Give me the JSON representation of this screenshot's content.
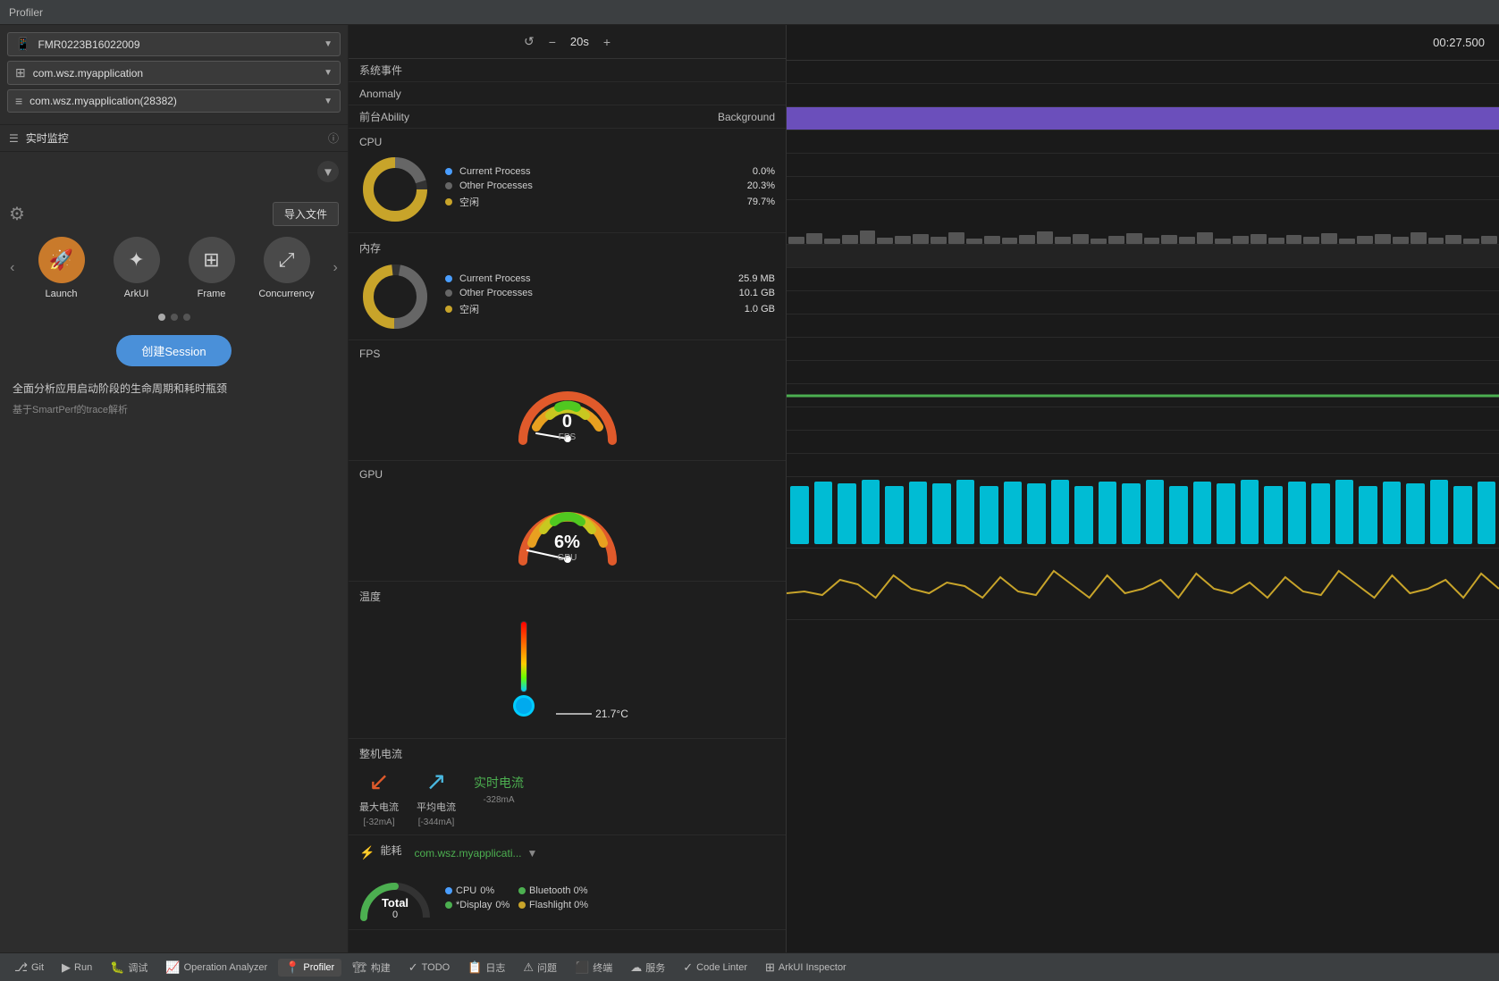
{
  "title_bar": {
    "label": "Profiler"
  },
  "left_panel": {
    "device": {
      "icon": "📱",
      "label": "FMR0223B16022009"
    },
    "app": {
      "icon": "⊞",
      "label": "com.wsz.myapplication"
    },
    "process": {
      "icon": "≡",
      "label": "com.wsz.myapplication(28382)"
    },
    "monitor": {
      "label": "实时监控"
    },
    "import_btn": "导入文件",
    "tools": [
      {
        "id": "launch",
        "icon": "🚀",
        "label": "Launch",
        "active": true
      },
      {
        "id": "arkui",
        "icon": "✦",
        "label": "ArkUI",
        "active": false
      },
      {
        "id": "frame",
        "icon": "⊞",
        "label": "Frame",
        "active": false
      },
      {
        "id": "concurrency",
        "icon": "⤢",
        "label": "Concurrency",
        "active": false
      }
    ],
    "create_session": "创建Session",
    "description": "全面分析应用启动阶段的生命周期和耗时瓶颈",
    "sub_description": "基于SmartPerf的trace解析"
  },
  "metrics": {
    "time_controls": {
      "reset": "↺",
      "minus": "−",
      "time": "20s",
      "plus": "+"
    },
    "events": {
      "sys_event_label": "系统事件",
      "anomaly_label": "Anomaly",
      "foreground_label": "前台Ability",
      "background_label": "Background"
    },
    "cpu": {
      "title": "CPU",
      "items": [
        {
          "color": "#4a9eff",
          "name": "Current Process",
          "value": "0.0%"
        },
        {
          "color": "#888",
          "name": "Other Processes",
          "value": "20.3%"
        },
        {
          "color": "#c8a42a",
          "name": "空闲",
          "value": "79.7%"
        }
      ]
    },
    "memory": {
      "title": "内存",
      "items": [
        {
          "color": "#4a9eff",
          "name": "Current Process",
          "value": "25.9 MB"
        },
        {
          "color": "#888",
          "name": "Other Processes",
          "value": "10.1 GB"
        },
        {
          "color": "#c8a42a",
          "name": "空闲",
          "value": "1.0 GB"
        }
      ]
    },
    "fps": {
      "title": "FPS",
      "value": "0",
      "unit": "FPS"
    },
    "gpu": {
      "title": "GPU",
      "value": "6%",
      "unit": "GPU"
    },
    "temperature": {
      "title": "温度",
      "value": "21.7°C"
    },
    "current": {
      "title": "整机电流",
      "max_label": "最大电流",
      "max_value": "[-32mA]",
      "avg_label": "平均电流",
      "avg_value": "[-344mA]",
      "realtime_label": "实时电流",
      "realtime_value": "-328mA"
    },
    "energy": {
      "title": "能耗",
      "total_label": "Total",
      "total_value": "0",
      "app_label": "com.wsz.myapplicati...",
      "legend": [
        {
          "color": "#4a9eff",
          "name": "CPU",
          "value": "0%"
        },
        {
          "color": "#4caf50",
          "name": "*Display",
          "value": "0%"
        },
        {
          "color": "#4caf50",
          "name": "Bluetooth",
          "value": "0%"
        },
        {
          "color": "#c8a42a",
          "name": "Flashlight",
          "value": "0%"
        }
      ]
    }
  },
  "timeline": {
    "time_label": "00:27.500"
  },
  "taskbar": {
    "items": [
      {
        "icon": "⎇",
        "label": "Git"
      },
      {
        "icon": "▶",
        "label": "Run"
      },
      {
        "icon": "🐛",
        "label": "调试"
      },
      {
        "icon": "📈",
        "label": "Operation Analyzer"
      },
      {
        "icon": "📍",
        "label": "Profiler",
        "active": true
      },
      {
        "icon": "🏗",
        "label": "构建"
      },
      {
        "icon": "✓",
        "label": "TODO"
      },
      {
        "icon": "📋",
        "label": "日志"
      },
      {
        "icon": "⚠",
        "label": "问题"
      },
      {
        "icon": "⬛",
        "label": "终端"
      },
      {
        "icon": "☁",
        "label": "服务"
      },
      {
        "icon": "✓",
        "label": "Code Linter"
      },
      {
        "icon": "⊞",
        "label": "ArkUI Inspector"
      }
    ]
  }
}
